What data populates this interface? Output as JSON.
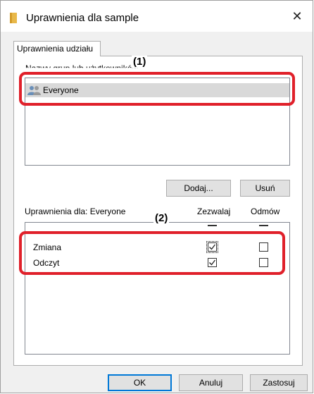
{
  "window": {
    "title": "Uprawnienia dla sample",
    "close_glyph": "✕"
  },
  "tabs": [
    {
      "label": "Uprawnienia udziału"
    }
  ],
  "users": {
    "group_label": "Nazwy grup lub użytkowników:",
    "items": [
      {
        "label": "Everyone",
        "icon": "users-icon"
      }
    ],
    "add_button": "Dodaj...",
    "remove_button": "Usuń"
  },
  "permissions": {
    "header_label": "Uprawnienia dla: Everyone",
    "allow_header": "Zezwalaj",
    "deny_header": "Odmów",
    "rows": [
      {
        "label": "Zmiana",
        "allow": true,
        "deny": false
      },
      {
        "label": "Odczyt",
        "allow": true,
        "deny": false
      }
    ]
  },
  "footer": {
    "ok": "OK",
    "cancel": "Anuluj",
    "apply": "Zastosuj"
  },
  "annotations": {
    "label_1": "(1)",
    "label_2": "(2)",
    "color": "#e0202a"
  }
}
